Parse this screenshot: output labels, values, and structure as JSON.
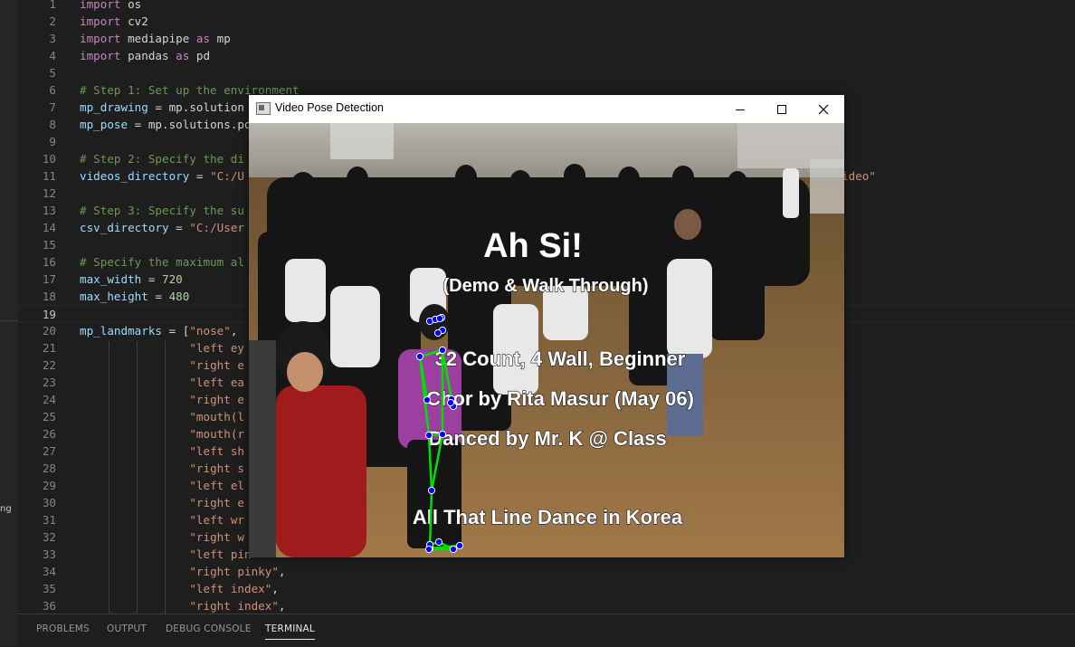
{
  "activity_bar": {
    "label_fragment": "ng"
  },
  "editor": {
    "current_line": 19,
    "lines": [
      {
        "n": "1",
        "tokens": [
          [
            "kw",
            "import"
          ],
          [
            "plain",
            " os"
          ]
        ]
      },
      {
        "n": "2",
        "tokens": [
          [
            "kw",
            "import"
          ],
          [
            "plain",
            " cv2"
          ]
        ]
      },
      {
        "n": "3",
        "tokens": [
          [
            "kw",
            "import"
          ],
          [
            "plain",
            " mediapipe "
          ],
          [
            "kw",
            "as"
          ],
          [
            "plain",
            " mp"
          ]
        ]
      },
      {
        "n": "4",
        "tokens": [
          [
            "kw",
            "import"
          ],
          [
            "plain",
            " pandas "
          ],
          [
            "kw",
            "as"
          ],
          [
            "plain",
            " pd"
          ]
        ]
      },
      {
        "n": "5",
        "tokens": []
      },
      {
        "n": "6",
        "tokens": [
          [
            "com",
            "# Step 1: Set up the environment"
          ]
        ]
      },
      {
        "n": "7",
        "tokens": [
          [
            "var",
            "mp_drawing"
          ],
          [
            "op",
            " = "
          ],
          [
            "plain",
            "mp.solution"
          ]
        ]
      },
      {
        "n": "8",
        "tokens": [
          [
            "var",
            "mp_pose"
          ],
          [
            "op",
            " = "
          ],
          [
            "plain",
            "mp.solutions.po"
          ]
        ]
      },
      {
        "n": "9",
        "tokens": []
      },
      {
        "n": "10",
        "tokens": [
          [
            "com",
            "# Step 2: Specify the di"
          ]
        ]
      },
      {
        "n": "11",
        "tokens": [
          [
            "var",
            "videos_directory"
          ],
          [
            "op",
            " = "
          ],
          [
            "str",
            "\"C:/U"
          ]
        ],
        "right": "ideo\""
      },
      {
        "n": "12",
        "tokens": []
      },
      {
        "n": "13",
        "tokens": [
          [
            "com",
            "# Step 3: Specify the su"
          ]
        ]
      },
      {
        "n": "14",
        "tokens": [
          [
            "var",
            "csv_directory"
          ],
          [
            "op",
            " = "
          ],
          [
            "str",
            "\"C:/User"
          ]
        ]
      },
      {
        "n": "15",
        "tokens": []
      },
      {
        "n": "16",
        "tokens": [
          [
            "com",
            "# Specify the maximum al"
          ]
        ]
      },
      {
        "n": "17",
        "tokens": [
          [
            "var",
            "max_width"
          ],
          [
            "op",
            " = "
          ],
          [
            "num",
            "720"
          ]
        ]
      },
      {
        "n": "18",
        "tokens": [
          [
            "var",
            "max_height"
          ],
          [
            "op",
            " = "
          ],
          [
            "num",
            "480"
          ]
        ]
      },
      {
        "n": "19",
        "tokens": []
      },
      {
        "n": "20",
        "tokens": [
          [
            "var",
            "mp_landmarks"
          ],
          [
            "op",
            " = "
          ],
          [
            "plain",
            "["
          ],
          [
            "str",
            "\"nose\""
          ],
          [
            "plain",
            ","
          ]
        ]
      },
      {
        "n": "21",
        "tokens": [
          [
            "plain",
            "                "
          ],
          [
            "str",
            "\"left ey"
          ]
        ]
      },
      {
        "n": "22",
        "tokens": [
          [
            "plain",
            "                "
          ],
          [
            "str",
            "\"right e"
          ]
        ]
      },
      {
        "n": "23",
        "tokens": [
          [
            "plain",
            "                "
          ],
          [
            "str",
            "\"left ea"
          ]
        ]
      },
      {
        "n": "24",
        "tokens": [
          [
            "plain",
            "                "
          ],
          [
            "str",
            "\"right e"
          ]
        ]
      },
      {
        "n": "25",
        "tokens": [
          [
            "plain",
            "                "
          ],
          [
            "str",
            "\"mouth(l"
          ]
        ]
      },
      {
        "n": "26",
        "tokens": [
          [
            "plain",
            "                "
          ],
          [
            "str",
            "\"mouth(r"
          ]
        ]
      },
      {
        "n": "27",
        "tokens": [
          [
            "plain",
            "                "
          ],
          [
            "str",
            "\"left sh"
          ]
        ]
      },
      {
        "n": "28",
        "tokens": [
          [
            "plain",
            "                "
          ],
          [
            "str",
            "\"right s"
          ]
        ]
      },
      {
        "n": "29",
        "tokens": [
          [
            "plain",
            "                "
          ],
          [
            "str",
            "\"left el"
          ]
        ]
      },
      {
        "n": "30",
        "tokens": [
          [
            "plain",
            "                "
          ],
          [
            "str",
            "\"right e"
          ]
        ]
      },
      {
        "n": "31",
        "tokens": [
          [
            "plain",
            "                "
          ],
          [
            "str",
            "\"left wr"
          ]
        ]
      },
      {
        "n": "32",
        "tokens": [
          [
            "plain",
            "                "
          ],
          [
            "str",
            "\"right w"
          ]
        ]
      },
      {
        "n": "33",
        "tokens": [
          [
            "plain",
            "                "
          ],
          [
            "str",
            "\"left pin"
          ]
        ]
      },
      {
        "n": "34",
        "tokens": [
          [
            "plain",
            "                "
          ],
          [
            "str",
            "\"right pinky\""
          ],
          [
            "plain",
            ","
          ]
        ]
      },
      {
        "n": "35",
        "tokens": [
          [
            "plain",
            "                "
          ],
          [
            "str",
            "\"left index\""
          ],
          [
            "plain",
            ","
          ]
        ]
      },
      {
        "n": "36",
        "tokens": [
          [
            "plain",
            "                "
          ],
          [
            "str",
            "\"right index\""
          ],
          [
            "plain",
            ","
          ]
        ]
      }
    ]
  },
  "panel": {
    "tabs": [
      {
        "label": "PROBLEMS",
        "active": false
      },
      {
        "label": "OUTPUT",
        "active": false
      },
      {
        "label": "DEBUG CONSOLE",
        "active": false
      },
      {
        "label": "TERMINAL",
        "active": true
      }
    ]
  },
  "video_window": {
    "title": "Video Pose Detection",
    "overlay": {
      "title": "Ah Si!",
      "subtitle": "(Demo & Walk Through)",
      "line1": "32 Count, 4 Wall, Beginner",
      "line2": "Chor by Rita Masur (May 06)",
      "line3": "Danced by Mr. K @ Class",
      "footer": "All That Line Dance in Korea"
    },
    "colors": {
      "skeleton": "#00e000",
      "landmark": "#0000ff"
    },
    "icons": {
      "minimize": "minimize-icon",
      "maximize": "maximize-icon",
      "close": "close-icon"
    }
  }
}
